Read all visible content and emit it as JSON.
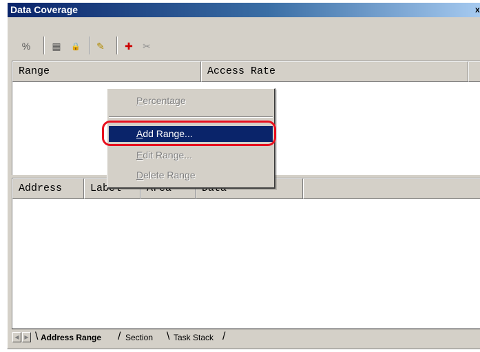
{
  "window": {
    "title": "Data Coverage",
    "close_glyph": "x"
  },
  "toolbar": [
    {
      "name": "percentage-icon",
      "glyph": "%"
    },
    {
      "name": "section-grid-icon",
      "glyph": "▦"
    },
    {
      "name": "lock-icon",
      "glyph": "🔒"
    },
    {
      "name": "edit-range-icon",
      "glyph": "✎"
    },
    {
      "name": "add-range-icon",
      "glyph": "✚"
    },
    {
      "name": "delete-range-icon",
      "glyph": "✂"
    }
  ],
  "upper_table": {
    "columns": [
      "Range",
      "Access Rate",
      ""
    ]
  },
  "lower_table": {
    "columns": [
      "Address",
      "Label",
      "Area",
      "Data",
      ""
    ]
  },
  "context_menu": {
    "items": [
      {
        "label": "Percentage",
        "underline": "P",
        "rest": "ercentage",
        "state": "disabled"
      },
      {
        "label": "Add Range...",
        "underline": "A",
        "rest": "dd Range...",
        "state": "selected"
      },
      {
        "label": "Edit Range...",
        "underline": "E",
        "rest": "dit Range...",
        "state": "disabled"
      },
      {
        "label": "Delete Range",
        "underline": "D",
        "rest": "elete Range",
        "state": "disabled"
      }
    ]
  },
  "tabs": {
    "scroll_left": "◀",
    "scroll_right": "▶",
    "items": [
      "Address Range",
      "Section",
      "Task Stack"
    ],
    "active": "Address Range"
  },
  "colors": {
    "selection": "#0a246a",
    "annotation_ring": "#e8101e",
    "window_face": "#d4d0c8"
  }
}
